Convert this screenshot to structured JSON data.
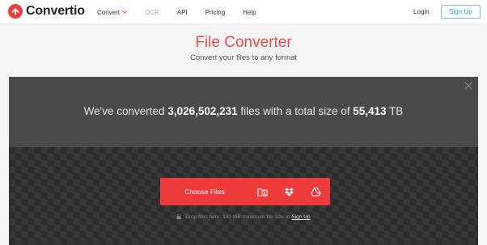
{
  "brand": {
    "name": "Convertio",
    "accent": "#e8403e"
  },
  "nav": {
    "items": [
      {
        "label": "Convert",
        "has_dropdown": true
      },
      {
        "label": "OCR",
        "muted": true
      },
      {
        "label": "API"
      },
      {
        "label": "Pricing"
      },
      {
        "label": "Help"
      }
    ],
    "login": "Login",
    "signup": "Sign Up"
  },
  "hero": {
    "title": "File Converter",
    "subtitle": "Convert your files to any format"
  },
  "stats": {
    "prefix": "We've converted",
    "files_count": "3,026,502,231",
    "middle": "files with a total size of",
    "total_size": "55,413",
    "unit": "TB"
  },
  "upload": {
    "choose_label": "Choose Files",
    "icons": [
      "folder-search-icon",
      "dropbox-icon",
      "google-drive-icon"
    ],
    "note_text": "Drop files here. 100 MB maximum file size or",
    "note_link": "Sign Up"
  }
}
